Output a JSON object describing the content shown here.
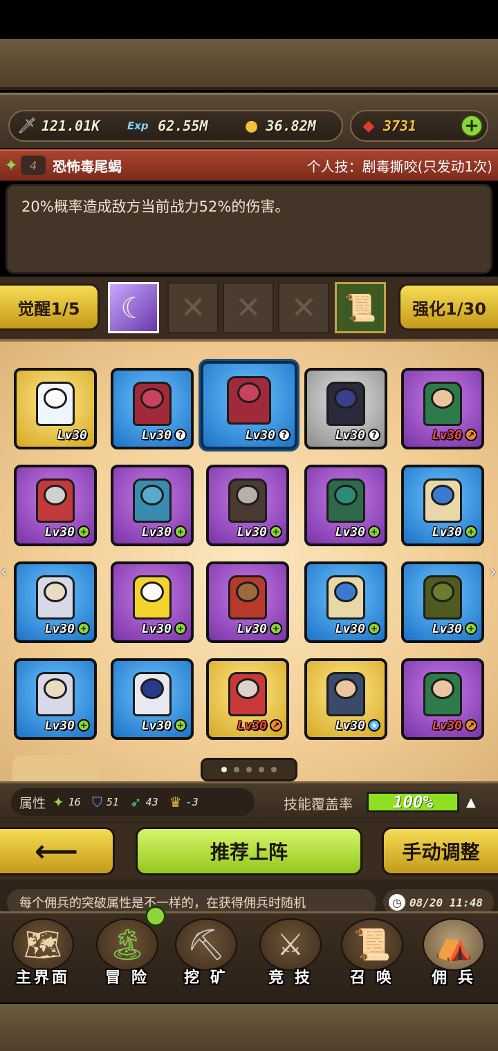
{
  "resources": {
    "attack": "121.01K",
    "exp": "62.55M",
    "gold": "36.82M",
    "gems": "3731"
  },
  "skill": {
    "level": "4",
    "unit_name": "恐怖毒尾蝎",
    "personal_skill": "个人技：剧毒撕咬(只发动1次)",
    "description": "20%概率造成敌方当前战力52%的伤害。"
  },
  "awaken": {
    "awaken_label": "觉醒1/5",
    "enhance_label": "强化1/30"
  },
  "cards": [
    {
      "rarity": "gold",
      "sprite": "white-bear",
      "level": "Lv30",
      "badge": ""
    },
    {
      "rarity": "blue",
      "sprite": "red-scorpion",
      "level": "Lv30",
      "badge": "?"
    },
    {
      "rarity": "blue",
      "sprite": "red-scorpion",
      "level": "Lv30",
      "badge": "?"
    },
    {
      "rarity": "grey",
      "sprite": "blue-haired-boy",
      "level": "Lv30",
      "badge": "?"
    },
    {
      "rarity": "purple",
      "sprite": "bearded-warrior",
      "level": "Lv30",
      "badge": "o",
      "lv_red": true
    },
    {
      "rarity": "purple",
      "sprite": "silver-knight",
      "level": "Lv30",
      "badge": "+"
    },
    {
      "rarity": "purple",
      "sprite": "blue-dragon",
      "level": "Lv30",
      "badge": "+"
    },
    {
      "rarity": "purple",
      "sprite": "grey-haired-mage",
      "level": "Lv30",
      "badge": "+"
    },
    {
      "rarity": "purple",
      "sprite": "green-haired-girl",
      "level": "Lv30",
      "badge": "+"
    },
    {
      "rarity": "blue",
      "sprite": "blue-twin-tails",
      "level": "Lv30",
      "badge": "+"
    },
    {
      "rarity": "blue",
      "sprite": "curly-blonde",
      "level": "Lv30",
      "badge": "+"
    },
    {
      "rarity": "purple",
      "sprite": "yellow-robot-cat",
      "level": "Lv30",
      "badge": "+"
    },
    {
      "rarity": "purple",
      "sprite": "goggles-pilot",
      "level": "Lv30",
      "badge": "+"
    },
    {
      "rarity": "blue",
      "sprite": "blue-twin-tails",
      "level": "Lv30",
      "badge": "+"
    },
    {
      "rarity": "blue",
      "sprite": "green-cloak",
      "level": "Lv30",
      "badge": "+"
    },
    {
      "rarity": "blue",
      "sprite": "curly-blonde",
      "level": "Lv30",
      "badge": "+"
    },
    {
      "rarity": "blue",
      "sprite": "sailor-girl",
      "level": "Lv30",
      "badge": "+"
    },
    {
      "rarity": "gold",
      "sprite": "old-wizard",
      "level": "Lv30",
      "badge": "o",
      "lv_red": true
    },
    {
      "rarity": "gold",
      "sprite": "bald-sage",
      "level": "Lv30",
      "badge": "s"
    },
    {
      "rarity": "purple",
      "sprite": "bearded-warrior",
      "level": "Lv30",
      "badge": "o",
      "lv_red": true
    }
  ],
  "attributes": {
    "label": "属性",
    "stat1": "16",
    "stat2": "51",
    "stat3": "43",
    "stat4": "-3",
    "coverage_label": "技能覆盖率",
    "coverage_value": "100%"
  },
  "actions": {
    "recommend": "推荐上阵",
    "manual": "手动调整"
  },
  "tip": {
    "text": "每个佣兵的突破属性是不一样的，在获得佣兵时随机",
    "time": "08/20 11:48"
  },
  "nav": {
    "main": "主界面",
    "adventure": "冒 险",
    "mining": "挖 矿",
    "arena": "竞 技",
    "summon": "召 唤",
    "mercenary": "佣 兵"
  },
  "colors": {
    "accent_green": "#8fd43a",
    "button_gold": "#e9c637",
    "skill_bar_red": "#a8432d"
  }
}
